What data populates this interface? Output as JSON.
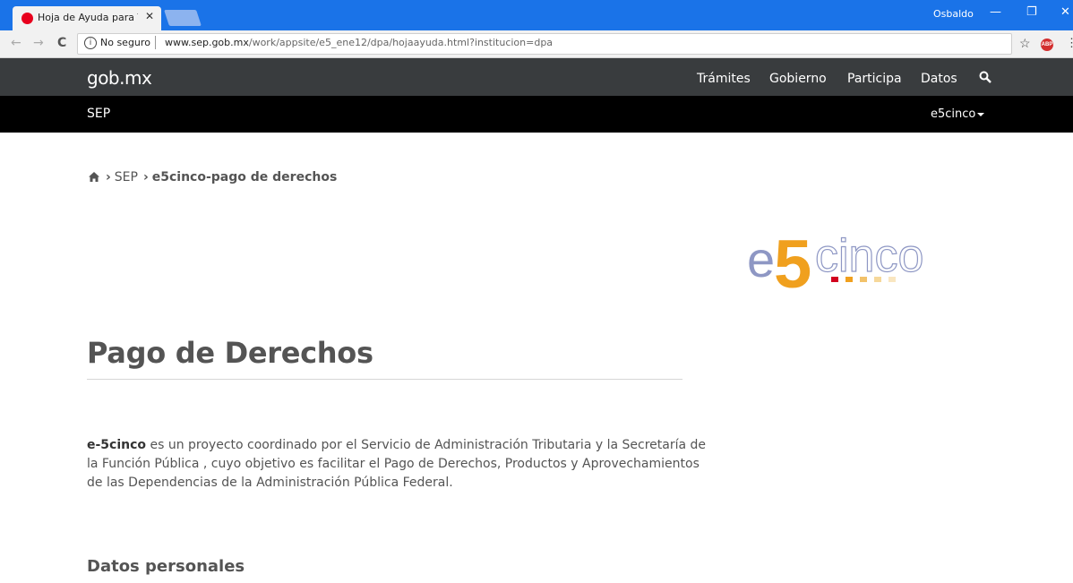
{
  "browser": {
    "tab_title": "Hoja de Ayuda para Trám",
    "tab_close": "✕",
    "profile_name": "Osbaldo",
    "minimize": "—",
    "restore": "❐",
    "close": "✕",
    "back": "←",
    "forward": "→",
    "reload": "C",
    "info": "i",
    "security_label": "No seguro",
    "url_host": "www.sep.gob.mx",
    "url_path": "/work/appsite/e5_ene12/dpa/hojaayuda.html?institucion=dpa",
    "star": "☆",
    "abp": "ABP",
    "menu": "⋮"
  },
  "header": {
    "logo": "gob.mx",
    "nav": [
      "Trámites",
      "Gobierno",
      "Participa",
      "Datos"
    ],
    "sub_label": "SEP",
    "dropdown_label": "e5cinco"
  },
  "breadcrumb": {
    "items": [
      "SEP",
      "e5cinco-pago de derechos"
    ]
  },
  "logo_text": {
    "e": "e",
    "five": "5",
    "cinco": "cinco"
  },
  "page": {
    "title": "Pago de Derechos",
    "intro_bold": "e-5cinco",
    "intro_rest": " es un proyecto coordinado por el Servicio de Administración Tributaria y la Secretaría de la Función Pública , cuyo objetivo es facilitar el Pago de Derechos, Productos y Aprovechamientos de las Dependencias de la Administración Pública Federal.",
    "section_title": "Datos personales"
  },
  "colors": {
    "chrome_blue": "#1a73e8",
    "gob_bar": "#393c3e",
    "sep_bar": "#000000",
    "text_gray": "#545454",
    "logo_orange": "#f0a01e",
    "logo_blue": "#8e97c4"
  }
}
